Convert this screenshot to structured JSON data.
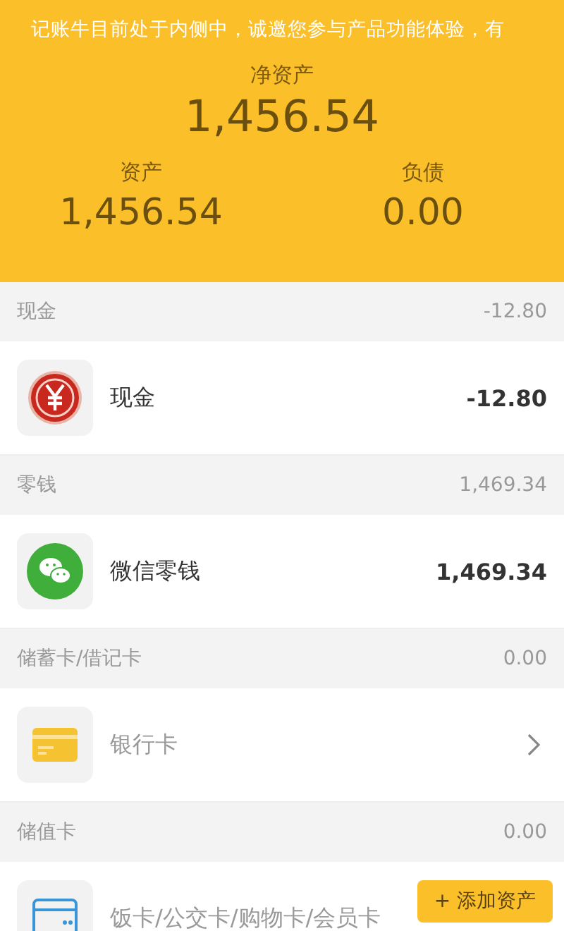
{
  "notice": "记账牛目前处于内侧中，诚邀您参与产品功能体验，有",
  "summary": {
    "net_label": "净资产",
    "net_value": "1,456.54",
    "assets_label": "资产",
    "assets_value": "1,456.54",
    "liabilities_label": "负债",
    "liabilities_value": "0.00"
  },
  "groups": [
    {
      "name": "现金",
      "total": "-12.80",
      "items": [
        {
          "kind": "account",
          "name": "现金",
          "amount": "-12.80"
        }
      ]
    },
    {
      "name": "零钱",
      "total": "1,469.34",
      "items": [
        {
          "kind": "account",
          "name": "微信零钱",
          "amount": "1,469.34"
        }
      ]
    },
    {
      "name": "储蓄卡/借记卡",
      "total": "0.00",
      "items": [
        {
          "kind": "empty",
          "name": "银行卡",
          "chevron": true
        }
      ]
    },
    {
      "name": "储值卡",
      "total": "0.00",
      "items": [
        {
          "kind": "empty",
          "name": "饭卡/公交卡/购物卡/会员卡",
          "chevron": false
        }
      ]
    }
  ],
  "add_button": "+ 添加资产"
}
